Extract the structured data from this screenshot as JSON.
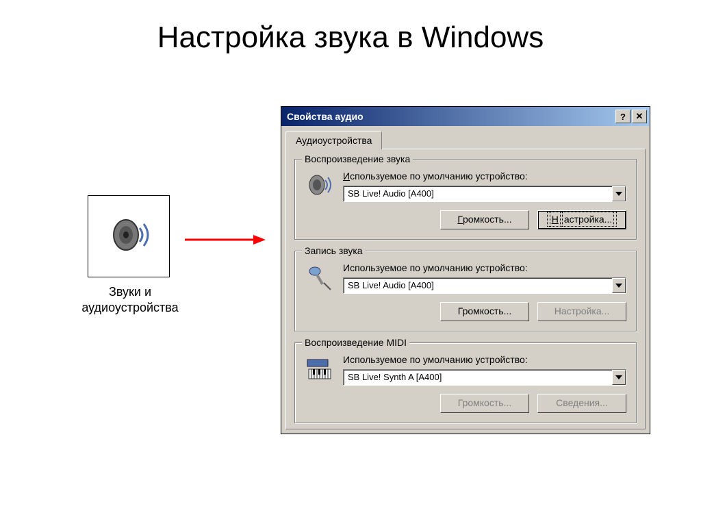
{
  "slide": {
    "title": "Настройка звука в Windows",
    "icon_label": "Звуки и аудиоустройства"
  },
  "dialog": {
    "title": "Свойства аудио",
    "help_btn": "?",
    "close_btn": "✕",
    "tab": "Аудиоустройства",
    "groups": {
      "playback": {
        "legend": "Воспроизведение звука",
        "label_pre": "И",
        "label_rest": "спользуемое по умолчанию устройство:",
        "device": "SB Live! Audio [A400]",
        "btn_volume_pre": "Г",
        "btn_volume_rest": "ромкость...",
        "btn_settings_pre": "Н",
        "btn_settings_rest": "астройка..."
      },
      "recording": {
        "legend": "Запись звука",
        "label_rest": "Используемое по умолчанию устройство:",
        "device": "SB Live! Audio [A400]",
        "btn_volume": "Громкость...",
        "btn_settings": "Настройка..."
      },
      "midi": {
        "legend": "Воспроизведение MIDI",
        "label_rest": "Используемое по умолчанию устройство:",
        "device": "SB Live! Synth A [A400]",
        "btn_volume": "Громкость...",
        "btn_info": "Сведения..."
      }
    }
  }
}
